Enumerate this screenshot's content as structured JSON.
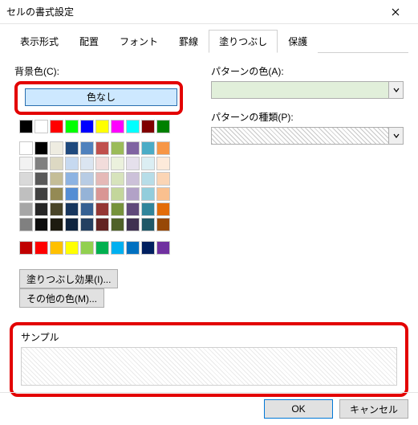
{
  "title": "セルの書式設定",
  "tabs": [
    "表示形式",
    "配置",
    "フォント",
    "罫線",
    "塗りつぶし",
    "保護"
  ],
  "active_tab": 4,
  "labels": {
    "bg_color": "背景色(C):",
    "no_color": "色なし",
    "pattern_color": "パターンの色(A):",
    "pattern_type": "パターンの種類(P):",
    "fill_effects": "塗りつぶし効果(I)...",
    "more_colors": "その他の色(M)...",
    "sample": "サンプル"
  },
  "buttons": {
    "ok": "OK",
    "cancel": "キャンセル"
  },
  "palette_row1": [
    "#000000",
    "#ffffff",
    "#ff0000",
    "#00ff00",
    "#0000ff",
    "#ffff00",
    "#ff00ff",
    "#00ffff",
    "#800000",
    "#008000"
  ],
  "palette_theme": [
    [
      "#ffffff",
      "#f2f2f2",
      "#d9d9d9",
      "#bfbfbf",
      "#a6a6a6",
      "#808080"
    ],
    [
      "#000000",
      "#808080",
      "#595959",
      "#404040",
      "#262626",
      "#0d0d0d"
    ],
    [
      "#eeece1",
      "#ddd9c3",
      "#c4bd97",
      "#948a54",
      "#494529",
      "#1d1b10"
    ],
    [
      "#1f497d",
      "#c6d9f0",
      "#8db3e2",
      "#548dd4",
      "#17365d",
      "#0f243e"
    ],
    [
      "#4f81bd",
      "#dbe5f1",
      "#b8cce4",
      "#95b3d7",
      "#366092",
      "#244061"
    ],
    [
      "#c0504d",
      "#f2dcdb",
      "#e5b9b7",
      "#d99694",
      "#953734",
      "#632423"
    ],
    [
      "#9bbb59",
      "#ebf1dd",
      "#d7e3bc",
      "#c3d69b",
      "#76923c",
      "#4f6128"
    ],
    [
      "#8064a2",
      "#e5e0ec",
      "#ccc1d9",
      "#b2a2c7",
      "#5f497a",
      "#3f3151"
    ],
    [
      "#4bacc6",
      "#dbeef3",
      "#b7dde8",
      "#92cddc",
      "#31859b",
      "#205867"
    ],
    [
      "#f79646",
      "#fdeada",
      "#fbd5b5",
      "#fac08f",
      "#e36c09",
      "#974806"
    ]
  ],
  "palette_std": [
    "#c00000",
    "#ff0000",
    "#ffc000",
    "#ffff00",
    "#92d050",
    "#00b050",
    "#00b0f0",
    "#0070c0",
    "#002060",
    "#7030a0"
  ]
}
